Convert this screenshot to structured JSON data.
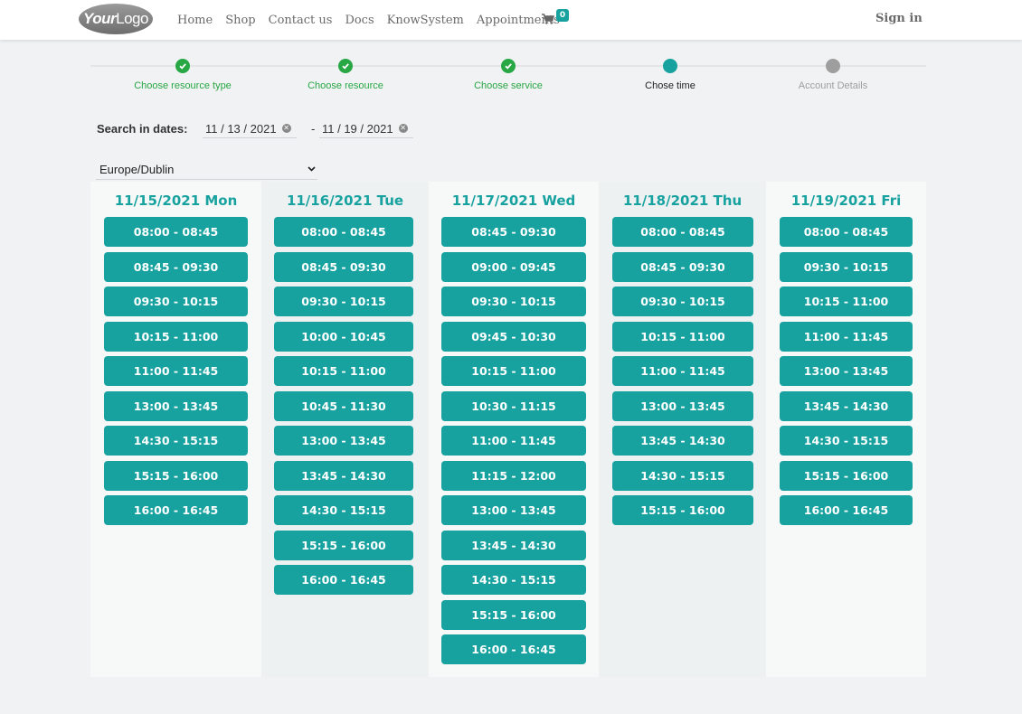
{
  "navbar": {
    "logo_part1": "Your",
    "logo_part2": "Logo",
    "links": [
      "Home",
      "Shop",
      "Contact us",
      "Docs",
      "KnowSystem",
      "Appointments"
    ],
    "cart_count": "0",
    "sign_in": "Sign in"
  },
  "stepper": {
    "steps": [
      {
        "label": "Choose resource type",
        "state": "done"
      },
      {
        "label": "Choose resource",
        "state": "done"
      },
      {
        "label": "Choose service",
        "state": "done"
      },
      {
        "label": "Chose time",
        "state": "active"
      },
      {
        "label": "Account Details",
        "state": "pending"
      }
    ]
  },
  "search": {
    "label": "Search in dates:",
    "date_from": "11 / 13 / 2021",
    "date_to": "11 / 19 / 2021",
    "separator": "-",
    "timezone": "Europe/Dublin"
  },
  "days": [
    {
      "header": "11/15/2021 Mon",
      "slots": [
        "08:00 - 08:45",
        "08:45 - 09:30",
        "09:30 - 10:15",
        "10:15 - 11:00",
        "11:00 - 11:45",
        "13:00 - 13:45",
        "14:30 - 15:15",
        "15:15 - 16:00",
        "16:00 - 16:45"
      ]
    },
    {
      "header": "11/16/2021 Tue",
      "slots": [
        "08:00 - 08:45",
        "08:45 - 09:30",
        "09:30 - 10:15",
        "10:00 - 10:45",
        "10:15 - 11:00",
        "10:45 - 11:30",
        "13:00 - 13:45",
        "13:45 - 14:30",
        "14:30 - 15:15",
        "15:15 - 16:00",
        "16:00 - 16:45"
      ]
    },
    {
      "header": "11/17/2021 Wed",
      "slots": [
        "08:45 - 09:30",
        "09:00 - 09:45",
        "09:30 - 10:15",
        "09:45 - 10:30",
        "10:15 - 11:00",
        "10:30 - 11:15",
        "11:00 - 11:45",
        "11:15 - 12:00",
        "13:00 - 13:45",
        "13:45 - 14:30",
        "14:30 - 15:15",
        "15:15 - 16:00",
        "16:00 - 16:45"
      ]
    },
    {
      "header": "11/18/2021 Thu",
      "slots": [
        "08:00 - 08:45",
        "08:45 - 09:30",
        "09:30 - 10:15",
        "10:15 - 11:00",
        "11:00 - 11:45",
        "13:00 - 13:45",
        "13:45 - 14:30",
        "14:30 - 15:15",
        "15:15 - 16:00"
      ]
    },
    {
      "header": "11/19/2021 Fri",
      "slots": [
        "08:00 - 08:45",
        "09:30 - 10:15",
        "10:15 - 11:00",
        "11:00 - 11:45",
        "13:00 - 13:45",
        "13:45 - 14:30",
        "14:30 - 15:15",
        "15:15 - 16:00",
        "16:00 - 16:45"
      ]
    }
  ],
  "colors": {
    "accent": "#17a2a0",
    "done": "#28a745",
    "pending": "#9e9e9e"
  }
}
